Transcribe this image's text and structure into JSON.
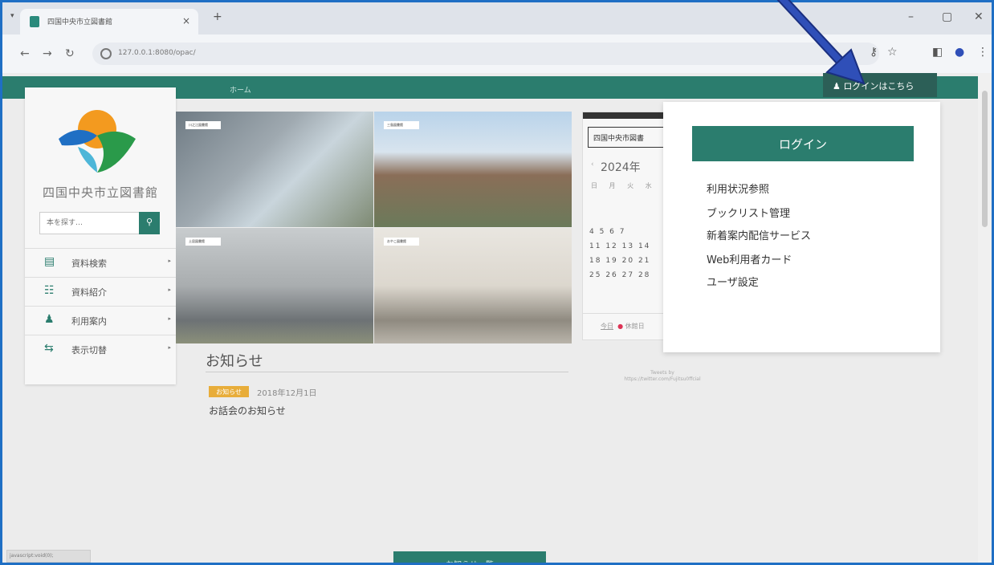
{
  "browser": {
    "tab_title": "四国中央市立図書館",
    "url": "127.0.0.1:8080/opac/",
    "new_tab": "+",
    "close_tab": "×",
    "minimize": "–",
    "restore": "▢",
    "close_window": "✕"
  },
  "header": {
    "home_link": "ホーム",
    "login_button": "ログインはこちら"
  },
  "sidebar": {
    "library_name": "四国中央市立図書館",
    "search_placeholder": "本を探す…",
    "items": [
      {
        "label": "資料検索",
        "icon": "document-search-icon"
      },
      {
        "label": "資料紹介",
        "icon": "book-open-icon"
      },
      {
        "label": "利用案内",
        "icon": "person-icon"
      },
      {
        "label": "表示切替",
        "icon": "switch-icon"
      }
    ]
  },
  "photos": [
    {
      "label": "川之江図書館"
    },
    {
      "label": "三島図書館"
    },
    {
      "label": "土居図書館"
    },
    {
      "label": "おやこ図書館"
    }
  ],
  "news": {
    "heading": "お知らせ",
    "badge": "お知らせ",
    "date": "2018年12月1日",
    "title": "お話会のお知らせ",
    "all_button": "お知らせ一覧"
  },
  "calendar": {
    "name": "四国中央市図書",
    "year": "2024年",
    "dow": "日 月 火 水",
    "rows": [
      "4  5  6  7",
      "11 12 13 14",
      "18 19 20 21",
      "25 26 27 28"
    ],
    "today": "今日",
    "closed": "休館日"
  },
  "tweets": {
    "line1": "Tweets by",
    "line2": "https://twitter.com/Fujitsu0ffcial"
  },
  "login_dropdown": {
    "button": "ログイン",
    "items": [
      "利用状況参照",
      "ブックリスト管理",
      "新着案内配信サービス",
      "Web利用者カード",
      "ユーザ設定"
    ]
  },
  "status_bar": "javascript:void(0);",
  "colors": {
    "accent": "#2b7d6e",
    "login_bar": "#2c5f57",
    "badge": "#e8ad3a",
    "annotation_arrow": "#2f4fb8"
  }
}
